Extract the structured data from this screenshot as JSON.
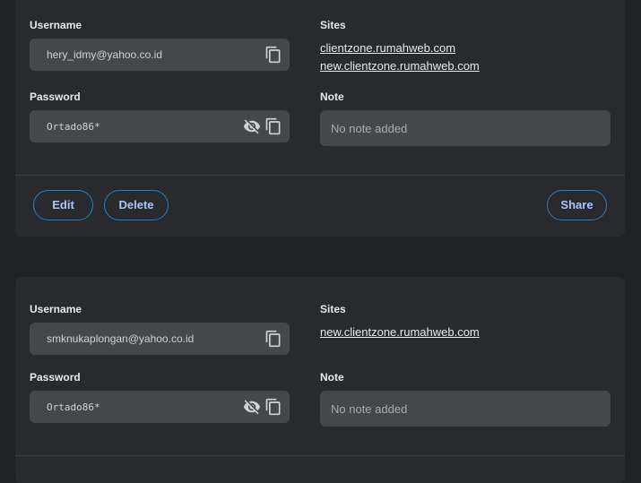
{
  "entries": [
    {
      "username_label": "Username",
      "username": "hery_idmy@yahoo.co.id",
      "password_label": "Password",
      "password": "Ortado86*",
      "sites_label": "Sites",
      "sites": [
        "clientzone.rumahweb.com",
        "new.clientzone.rumahweb.com"
      ],
      "note_label": "Note",
      "note": "No note added",
      "actions": {
        "edit": "Edit",
        "delete": "Delete",
        "share": "Share"
      }
    },
    {
      "username_label": "Username",
      "username": "smknukaplongan@yahoo.co.id",
      "password_label": "Password",
      "password": "Ortado86*",
      "sites_label": "Sites",
      "sites": [
        "new.clientzone.rumahweb.com"
      ],
      "note_label": "Note",
      "note": "No note added"
    }
  ],
  "icons": {
    "copy": "copy-icon",
    "visibility_off": "eye-off-icon"
  },
  "colors": {
    "accent_border": "#2f7fb7",
    "accent_text": "#a8c7fa",
    "card_bg": "#292a2d",
    "field_bg": "#46474a"
  }
}
